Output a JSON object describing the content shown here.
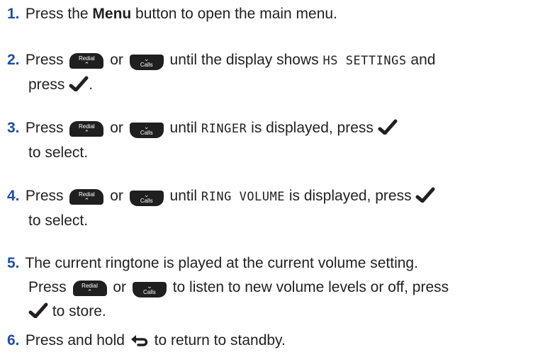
{
  "steps": [
    {
      "num": "1.",
      "p1": "Press the ",
      "bold": "Menu",
      "p2": " button to open the main menu."
    },
    {
      "num": "2.",
      "p1": "Press ",
      "or": " or ",
      "p2": " until the display shows ",
      "lcd": "HS SETTINGS",
      "p3": " and",
      "line2a": "press ",
      "line2b": "."
    },
    {
      "num": "3.",
      "p1": "Press ",
      "or": " or ",
      "p2": " until ",
      "lcd": "RINGER",
      "p3": " is displayed, press ",
      "line2": "to select."
    },
    {
      "num": "4.",
      "p1": "Press ",
      "or": " or ",
      "p2": " until ",
      "lcd": "RING VOLUME",
      "p3": " is displayed, press ",
      "line2": "to select."
    },
    {
      "num": "5.",
      "line1": "The current ringtone is played at the current volume setting.",
      "p1": "Press ",
      "or": " or ",
      "p2": " to listen to new volume levels or off, press",
      "line3": " to store."
    },
    {
      "num": "6.",
      "p1": "Press and hold ",
      "p2": " to return to standby."
    }
  ],
  "keys": {
    "redial": "Redial",
    "calls": "Calls",
    "up_glyph": "⌃",
    "down_glyph": "⌄"
  },
  "icons": {
    "check": "checkmark-icon",
    "back": "back-arrow-icon"
  },
  "colors": {
    "step_number": "#1f4fa3",
    "key_fill": "#1f1f1f",
    "text": "#231f20"
  }
}
